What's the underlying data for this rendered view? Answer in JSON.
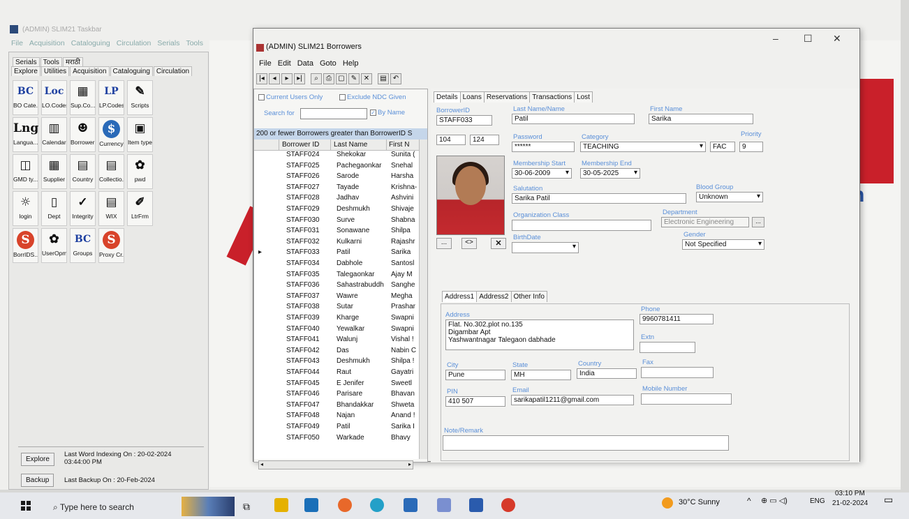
{
  "bg": {
    "title": "(ADMIN) SLIM21 Taskbar",
    "menu": [
      "File",
      "Acquisition",
      "Cataloguing",
      "Circulation",
      "Serials",
      "Tools"
    ],
    "tabs1": [
      "Serials",
      "Tools",
      "मराठी"
    ],
    "tabs2": [
      "Explore",
      "Utilities",
      "Acquisition",
      "Cataloguing",
      "Circulation"
    ],
    "icons": [
      {
        "ic": "BC",
        "lb": "BO Cate..."
      },
      {
        "ic": "Loc",
        "lb": "LO.Codes"
      },
      {
        "ic": "▦",
        "lb": "Sup.Co..."
      },
      {
        "ic": "LP",
        "lb": "LP.Codes"
      },
      {
        "ic": "✎",
        "lb": "Scripts"
      },
      {
        "ic": "Lng",
        "lb": "Langua..."
      },
      {
        "ic": "▥",
        "lb": "Calendar"
      },
      {
        "ic": "☻",
        "lb": "Borrowers"
      },
      {
        "ic": "$",
        "lb": "Currency"
      },
      {
        "ic": "▣",
        "lb": "Item types"
      },
      {
        "ic": "◫",
        "lb": "GMD ty..."
      },
      {
        "ic": "▦",
        "lb": "Supplier"
      },
      {
        "ic": "▤",
        "lb": "Country"
      },
      {
        "ic": "▤",
        "lb": "Collectio..."
      },
      {
        "ic": "✿",
        "lb": "pwd"
      },
      {
        "ic": "☼",
        "lb": "login"
      },
      {
        "ic": "▯",
        "lb": "Dept"
      },
      {
        "ic": "✓",
        "lb": "Integrity"
      },
      {
        "ic": "▤",
        "lb": "WIX"
      },
      {
        "ic": "✐",
        "lb": "LtrFrm"
      },
      {
        "ic": "S",
        "lb": "BorrIDS..."
      },
      {
        "ic": "✿",
        "lb": "UserOpm"
      },
      {
        "ic": "BC",
        "lb": "Groups"
      },
      {
        "ic": "S",
        "lb": "Proxy Cr..."
      }
    ],
    "explore_btn": "Explore",
    "backup_btn": "Backup",
    "last_indexing": "Last Word Indexing On : 20-02-2024 03:44:00 PM",
    "last_backup": "Last Backup On : 20-Feb-2024"
  },
  "win": {
    "title": "(ADMIN) SLIM21 Borrowers",
    "menu": [
      "File",
      "Edit",
      "Data",
      "Goto",
      "Help"
    ],
    "toolbar": [
      "|◂",
      "◂",
      "▸",
      "▸|",
      "⌕",
      "⎙",
      "▢",
      "✎",
      "✕",
      "▤",
      "↶"
    ]
  },
  "list": {
    "current_users_only": "Current Users Only",
    "exclude_ndc": "Exclude NDC Given",
    "search_label": "Search for",
    "by_name": "By Name",
    "header": "200 or fewer Borrowers greater than BorrowerID S",
    "columns": [
      "Borrower ID",
      "Last Name",
      "First N"
    ],
    "rows": [
      [
        "STAFF024",
        "Shekokar",
        "Sunita ("
      ],
      [
        "STAFF025",
        "Pachegaonkar",
        "Snehal"
      ],
      [
        "STAFF026",
        "Sarode",
        "Harsha"
      ],
      [
        "STAFF027",
        "Tayade",
        "Krishna-"
      ],
      [
        "STAFF028",
        "Jadhav",
        "Ashvini"
      ],
      [
        "STAFF029",
        "Deshmukh",
        "Shivaje"
      ],
      [
        "STAFF030",
        "Surve",
        "Shabna"
      ],
      [
        "STAFF031",
        "Sonawane",
        "Shilpa"
      ],
      [
        "STAFF032",
        "Kulkarni",
        "Rajashr"
      ],
      [
        "STAFF033",
        "Patil",
        "Sarika"
      ],
      [
        "STAFF034",
        "Dabhole",
        "Santosl"
      ],
      [
        "STAFF035",
        "Talegaonkar",
        "Ajay M"
      ],
      [
        "STAFF036",
        "Sahastrabuddh",
        "Sanghe"
      ],
      [
        "STAFF037",
        "Wawre",
        "Megha"
      ],
      [
        "STAFF038",
        "Sutar",
        "Prashar"
      ],
      [
        "STAFF039",
        "Kharge",
        "Swapni"
      ],
      [
        "STAFF040",
        "Yewalkar",
        "Swapni"
      ],
      [
        "STAFF041",
        "Walunj",
        "Vishal !"
      ],
      [
        "STAFF042",
        "Das",
        "Nabin C"
      ],
      [
        "STAFF043",
        "Deshmukh",
        "Shilpa !"
      ],
      [
        "STAFF044",
        "Raut",
        "Gayatri"
      ],
      [
        "STAFF045",
        "E Jenifer",
        "Sweetl"
      ],
      [
        "STAFF046",
        "Parisare",
        "Bhavan"
      ],
      [
        "STAFF047",
        "Bhandakkar",
        "Shweta"
      ],
      [
        "STAFF048",
        "Najan",
        "Anand !"
      ],
      [
        "STAFF049",
        "Patil",
        "Sarika I"
      ],
      [
        "STAFF050",
        "Warkade",
        "Bhavy"
      ]
    ],
    "selected_index": 9
  },
  "details": {
    "tabs": [
      "Details",
      "Loans",
      "Reservations",
      "Transactions",
      "Lost"
    ],
    "borrower_id_label": "BorrowerID",
    "borrower_id": "STAFF033",
    "last_name_label": "Last Name/Name",
    "last_name": "Patil",
    "first_name_label": "First Name",
    "first_name": "Sarika",
    "spin1": "104",
    "spin2": "124",
    "password_label": "Password",
    "password": "******",
    "category_label": "Category",
    "category": "TEACHING",
    "category_code": "FAC",
    "priority_label": "Priority",
    "priority": "9",
    "mstart_label": "Membership Start",
    "mstart": "30-06-2009",
    "mend_label": "Membership End",
    "mend": "30-05-2025",
    "salutation_label": "Salutation",
    "salutation": "Sarika Patil",
    "blood_label": "Blood Group",
    "blood": "Unknown",
    "org_label": "Organization Class",
    "org": "",
    "dept_label": "Department",
    "dept": "Electronic Engineering",
    "birth_label": "BirthDate",
    "birth": "",
    "gender_label": "Gender",
    "gender": "Not Specified",
    "photo_btns": [
      "...",
      "<>",
      "✕"
    ],
    "addr_tabs": [
      "Address1",
      "Address2",
      "Other Info"
    ],
    "address_label": "Address",
    "address": [
      "Flat. No.302,plot no.135",
      "Digambar Apt",
      "Yashwantnagar Talegaon dabhade"
    ],
    "phone_label": "Phone",
    "phone": "9960781411",
    "extn_label": "Extn",
    "extn": "",
    "city_label": "City",
    "city": "Pune",
    "state_label": "State",
    "state": "MH",
    "country_label": "Country",
    "country": "India",
    "fax_label": "Fax",
    "fax": "",
    "pin_label": "PIN",
    "pin": "410 507",
    "email_label": "Email",
    "email": "sarikapatil1211@gmail.com",
    "mobile_label": "Mobile Number",
    "mobile": "",
    "note_label": "Note/Remark"
  },
  "taskbar": {
    "search_placeholder": "Type here to search",
    "weather": "30°C  Sunny",
    "lang": "ENG",
    "time": "03:10 PM",
    "date": "21-02-2024"
  }
}
